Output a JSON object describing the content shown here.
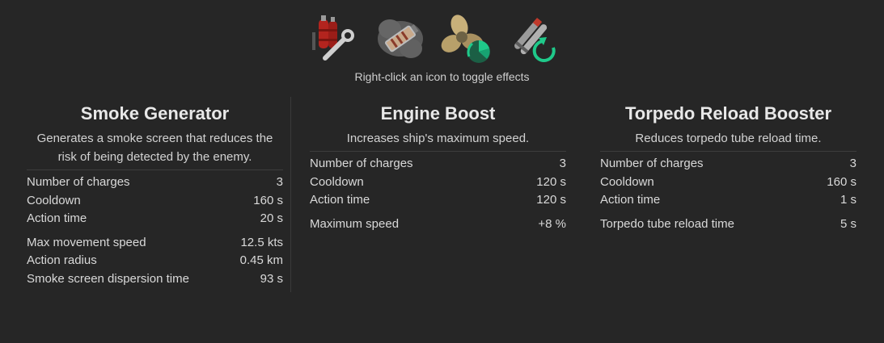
{
  "icons": [
    {
      "name": "damage-control-icon"
    },
    {
      "name": "smoke-generator-icon"
    },
    {
      "name": "engine-boost-icon"
    },
    {
      "name": "torpedo-reload-booster-icon"
    }
  ],
  "hint": "Right-click an icon to toggle effects",
  "panels": [
    {
      "title": "Smoke Generator",
      "description_line1": "Generates a smoke screen that reduces the",
      "description_line2": "risk of being detected by the enemy.",
      "base_stats": [
        {
          "label": "Number of charges",
          "value": "3"
        },
        {
          "label": "Cooldown",
          "value": "160 s"
        },
        {
          "label": "Action time",
          "value": "20 s"
        }
      ],
      "extra_stats": [
        {
          "label": "Max movement speed",
          "value": "12.5 kts"
        },
        {
          "label": "Action radius",
          "value": "0.45 km"
        },
        {
          "label": "Smoke screen dispersion time",
          "value": "93 s"
        }
      ]
    },
    {
      "title": "Engine Boost",
      "description_line1": "Increases ship's maximum speed.",
      "base_stats": [
        {
          "label": "Number of charges",
          "value": "3"
        },
        {
          "label": "Cooldown",
          "value": "120 s"
        },
        {
          "label": "Action time",
          "value": "120 s"
        }
      ],
      "extra_stats": [
        {
          "label": "Maximum speed",
          "value": "+8 %"
        }
      ]
    },
    {
      "title": "Torpedo Reload Booster",
      "description_line1": "Reduces torpedo tube reload time.",
      "base_stats": [
        {
          "label": "Number of charges",
          "value": "3"
        },
        {
          "label": "Cooldown",
          "value": "160 s"
        },
        {
          "label": "Action time",
          "value": "1 s"
        }
      ],
      "extra_stats": [
        {
          "label": "Torpedo tube reload time",
          "value": "5 s"
        }
      ]
    }
  ],
  "colors": {
    "background": "#262626",
    "accent_green": "#1fc98a",
    "text": "#d9d9d9"
  }
}
